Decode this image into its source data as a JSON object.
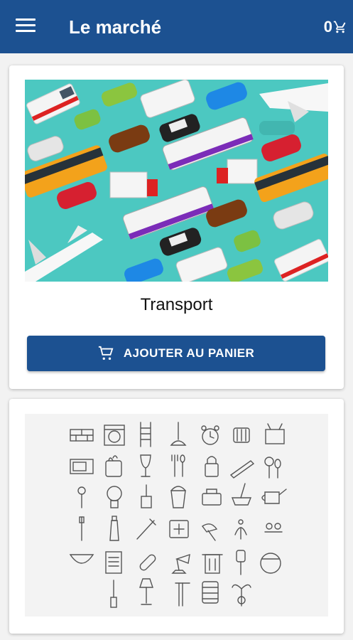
{
  "app": {
    "title": "Le marché",
    "cart_count": "0",
    "menu_icon": "hamburger-menu-icon",
    "cart_icon": "shopping-cart-icon",
    "brand_color": "#1c5191"
  },
  "products": [
    {
      "name": "Transport",
      "image": "transport-vehicles-illustration",
      "button_label": "AJOUTER AU PANIER",
      "button_icon": "shopping-cart-icon"
    },
    {
      "name": "",
      "image": "household-objects-icons-illustration"
    }
  ]
}
